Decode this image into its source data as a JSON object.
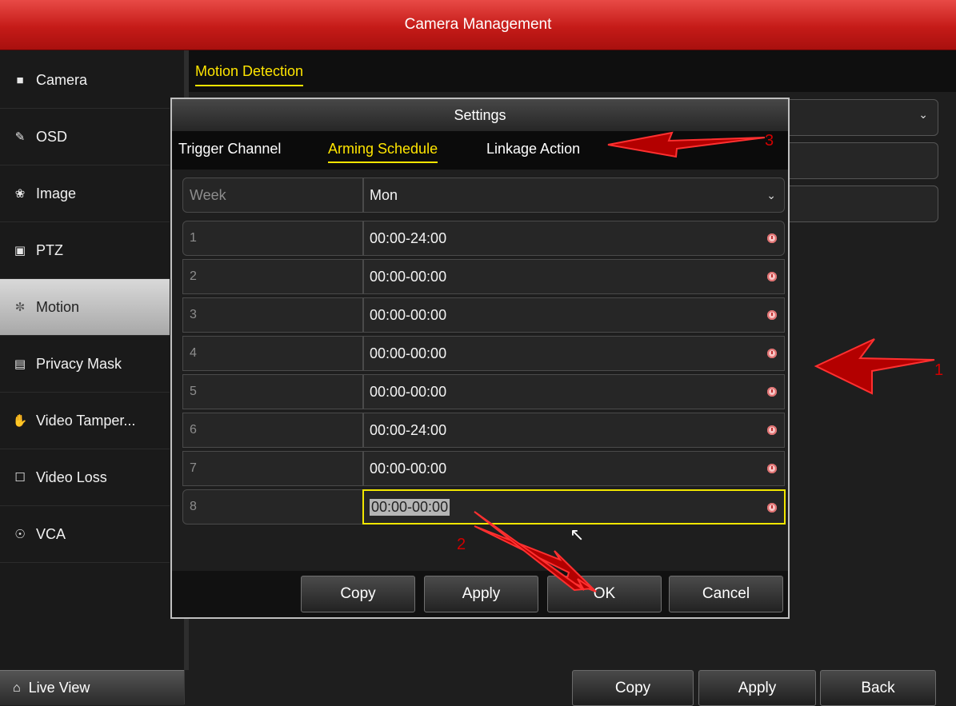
{
  "window": {
    "title": "Camera Management"
  },
  "sidebar": {
    "items": [
      {
        "label": "Camera",
        "icon": "camera-icon"
      },
      {
        "label": "OSD",
        "icon": "osd-icon"
      },
      {
        "label": "Image",
        "icon": "image-icon"
      },
      {
        "label": "PTZ",
        "icon": "ptz-icon"
      },
      {
        "label": "Motion",
        "icon": "motion-icon",
        "active": true
      },
      {
        "label": "Privacy Mask",
        "icon": "privacy-mask-icon"
      },
      {
        "label": "Video Tamper...",
        "icon": "hand-icon"
      },
      {
        "label": "Video Loss",
        "icon": "video-loss-icon"
      },
      {
        "label": "VCA",
        "icon": "vca-icon"
      }
    ],
    "live_view": {
      "label": "Live View",
      "icon": "home-icon"
    }
  },
  "main": {
    "tab": "Motion Detection",
    "buttons": {
      "copy": "Copy",
      "apply": "Apply",
      "back": "Back"
    }
  },
  "dialog": {
    "title": "Settings",
    "tabs": {
      "trigger_channel": "Trigger Channel",
      "arming_schedule": "Arming Schedule",
      "linkage_action": "Linkage Action"
    },
    "week": {
      "label": "Week",
      "value": "Mon"
    },
    "periods": [
      {
        "num": "1",
        "time": "00:00-24:00"
      },
      {
        "num": "2",
        "time": "00:00-00:00"
      },
      {
        "num": "3",
        "time": "00:00-00:00"
      },
      {
        "num": "4",
        "time": "00:00-00:00"
      },
      {
        "num": "5",
        "time": "00:00-00:00"
      },
      {
        "num": "6",
        "time": "00:00-24:00"
      },
      {
        "num": "7",
        "time": "00:00-00:00"
      },
      {
        "num": "8",
        "time": "00:00-00:00",
        "selected": true
      }
    ],
    "buttons": {
      "copy": "Copy",
      "apply": "Apply",
      "ok": "OK",
      "cancel": "Cancel"
    }
  },
  "annotations": {
    "one": "1",
    "two": "2",
    "three": "3"
  },
  "colors": {
    "accent_yellow": "#ffe500",
    "title_red": "#c51b18",
    "arrow_red": "#c00000"
  }
}
